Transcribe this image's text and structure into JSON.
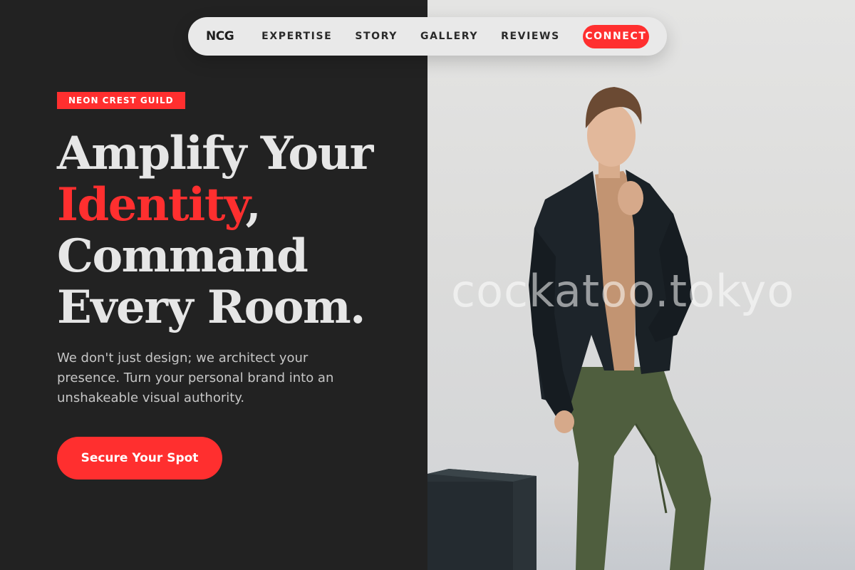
{
  "nav": {
    "logo": "NCG",
    "links": [
      "EXPERTISE",
      "STORY",
      "GALLERY",
      "REVIEWS"
    ],
    "cta": "CONNECT"
  },
  "hero": {
    "tag": "NEON CREST GUILD",
    "headline_line1": "Amplify Your",
    "headline_accent": "Identity",
    "headline_comma": ",",
    "headline_line3": "Command",
    "headline_line4": "Every Room.",
    "subtext": "We don't just design; we architect your presence. Turn your personal brand into an unshakeable visual authority.",
    "cta": "Secure Your Spot"
  },
  "photo": {
    "watermark": "cockatoo.tokyo"
  },
  "colors": {
    "accent": "#ff2f2f",
    "dark_bg": "#222222",
    "nav_bg": "#e9e9e9",
    "text_light": "#e6e6e6"
  }
}
